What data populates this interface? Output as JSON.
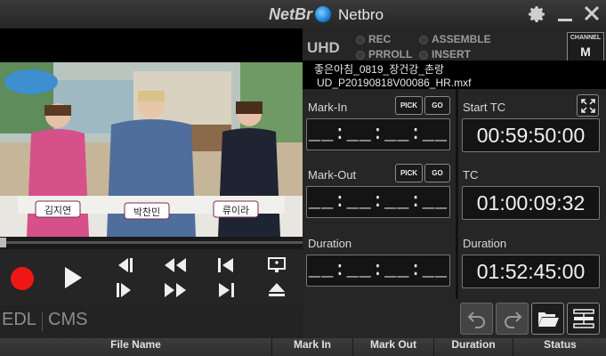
{
  "app": {
    "logo_text": "NetBr",
    "name": "Netbro"
  },
  "window_controls": {
    "settings_icon": "gear-icon",
    "minimize_icon": "minimize-icon",
    "close_icon": "close-icon"
  },
  "video": {
    "name_tags": [
      "김지연",
      "박찬민",
      "류이라"
    ],
    "seek_position": 0
  },
  "transport": {
    "buttons": [
      "record-icon",
      "play-icon",
      "prev-frame-icon",
      "next-frame-icon",
      "rewind-icon",
      "fast-forward-icon",
      "go-to-start-icon",
      "go-to-end-icon",
      "monitor-icon",
      "eject-icon"
    ]
  },
  "tabs": [
    {
      "label": "EDL"
    },
    {
      "label": "CMS"
    }
  ],
  "status": {
    "format": "UHD",
    "indicators": {
      "rec": "REC",
      "proll": "PRROLL",
      "assemble": "ASSEMBLE",
      "insert": "INSERT"
    },
    "channel_label": "CHANNEL",
    "channel_value": "M"
  },
  "file": {
    "title": "좋은아침_0819_장건강_촌랑",
    "filename": "UD_P20190818V00086_HR.mxf"
  },
  "mark_in": {
    "label": "Mark-In",
    "value": "__:__:__:__",
    "pick_label": "PICK",
    "go_label": "GO"
  },
  "mark_out": {
    "label": "Mark-Out",
    "value": "__:__:__:__",
    "pick_label": "PICK",
    "go_label": "GO"
  },
  "duration_left": {
    "label": "Duration",
    "value": "__:__:__:__"
  },
  "start_tc": {
    "label": "Start TC",
    "value": "00:59:50:00"
  },
  "tc": {
    "label": "TC",
    "value": "01:00:09:32"
  },
  "duration_right": {
    "label": "Duration",
    "value": "01:52:45:00"
  },
  "action_buttons": [
    "undo-icon",
    "redo-icon",
    "folder-open-icon",
    "edit-list-icon"
  ],
  "table": {
    "columns": [
      "File Name",
      "Mark In",
      "Mark Out",
      "Duration",
      "Status"
    ]
  }
}
